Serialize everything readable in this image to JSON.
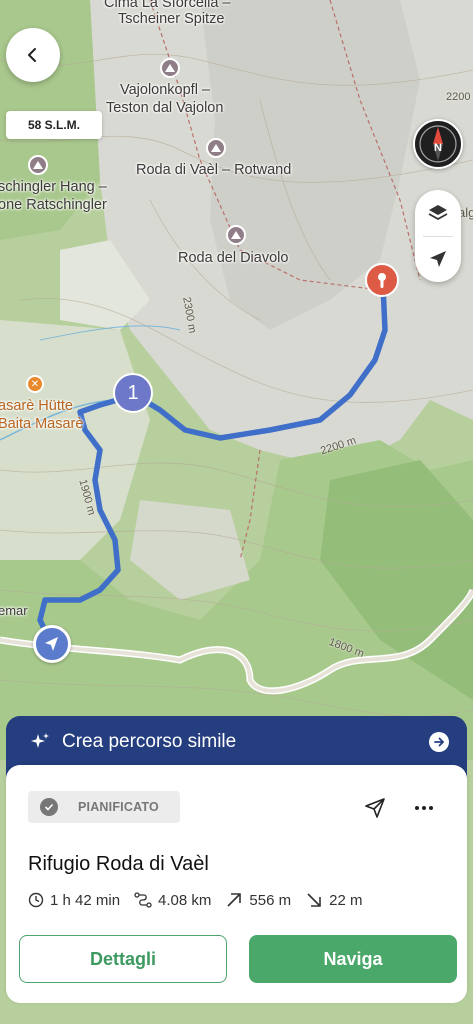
{
  "map": {
    "peaks": [
      {
        "name": "Cima La Sforcella –",
        "name2": "Tscheiner Spitze"
      },
      {
        "name": "Vajolonkopfl –",
        "name2": "Teston dal Vajolon"
      },
      {
        "name": "Roda di Vaèl – Rotwand"
      },
      {
        "name": "Roda del Diavolo"
      },
      {
        "name": "schingler Hang –",
        "name2": "one Ratschingler"
      }
    ],
    "hut": {
      "name": "asarè Hütte",
      "name2": "Baita Masarè"
    },
    "place_label": "emar",
    "contours": [
      "2300 m",
      "2200 m",
      "1900 m",
      "1800 m",
      "2200",
      "alg"
    ],
    "waypoint_number": "1"
  },
  "altitude": "58 S.L.M.",
  "icons": {
    "back": "chevron-left-icon",
    "compass": "compass-icon",
    "layers": "layers-icon",
    "locate": "navigation-arrow-icon",
    "sparkle": "sparkle-icon",
    "share": "share-icon",
    "more": "more-horizontal-icon",
    "clock": "clock-icon",
    "distance": "route-icon",
    "ascent": "arrow-up-right-icon",
    "descent": "arrow-down-right-icon",
    "status": "check-circle-icon"
  },
  "similar_route": {
    "label": "Crea percorso simile"
  },
  "route": {
    "status": "PIANIFICATO",
    "title": "Rifugio Roda di Vaèl",
    "duration": "1 h 42 min",
    "distance": "4.08 km",
    "ascent": "556 m",
    "descent": "22 m"
  },
  "actions": {
    "details": "Dettagli",
    "navigate": "Naviga"
  },
  "colors": {
    "route": "#4a74c9",
    "pin": "#dd5b45",
    "primary": "#4aa86a",
    "banner": "#243e80"
  }
}
